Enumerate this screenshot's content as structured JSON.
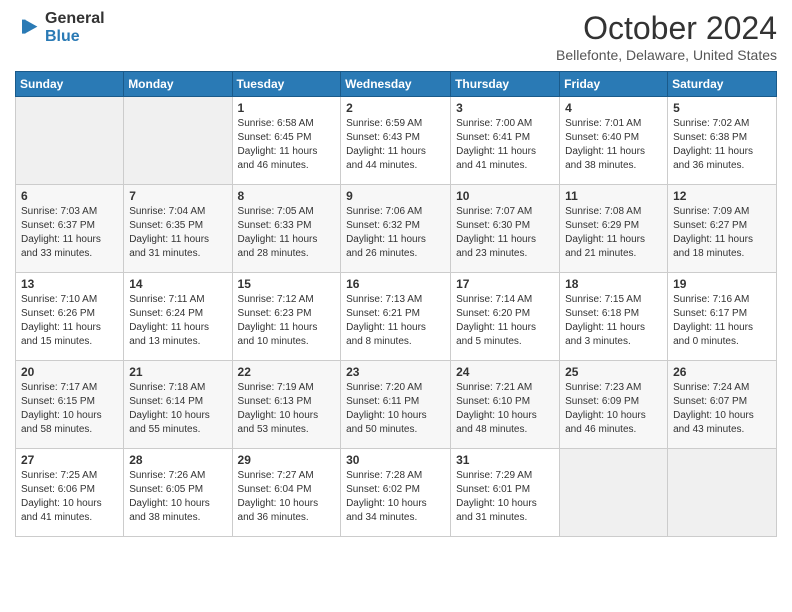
{
  "header": {
    "title": "October 2024",
    "location": "Bellefonte, Delaware, United States",
    "logo_general": "General",
    "logo_blue": "Blue"
  },
  "weekdays": [
    "Sunday",
    "Monday",
    "Tuesday",
    "Wednesday",
    "Thursday",
    "Friday",
    "Saturday"
  ],
  "weeks": [
    [
      {
        "day": "",
        "info": ""
      },
      {
        "day": "",
        "info": ""
      },
      {
        "day": "1",
        "info": "Sunrise: 6:58 AM\nSunset: 6:45 PM\nDaylight: 11 hours and 46 minutes."
      },
      {
        "day": "2",
        "info": "Sunrise: 6:59 AM\nSunset: 6:43 PM\nDaylight: 11 hours and 44 minutes."
      },
      {
        "day": "3",
        "info": "Sunrise: 7:00 AM\nSunset: 6:41 PM\nDaylight: 11 hours and 41 minutes."
      },
      {
        "day": "4",
        "info": "Sunrise: 7:01 AM\nSunset: 6:40 PM\nDaylight: 11 hours and 38 minutes."
      },
      {
        "day": "5",
        "info": "Sunrise: 7:02 AM\nSunset: 6:38 PM\nDaylight: 11 hours and 36 minutes."
      }
    ],
    [
      {
        "day": "6",
        "info": "Sunrise: 7:03 AM\nSunset: 6:37 PM\nDaylight: 11 hours and 33 minutes."
      },
      {
        "day": "7",
        "info": "Sunrise: 7:04 AM\nSunset: 6:35 PM\nDaylight: 11 hours and 31 minutes."
      },
      {
        "day": "8",
        "info": "Sunrise: 7:05 AM\nSunset: 6:33 PM\nDaylight: 11 hours and 28 minutes."
      },
      {
        "day": "9",
        "info": "Sunrise: 7:06 AM\nSunset: 6:32 PM\nDaylight: 11 hours and 26 minutes."
      },
      {
        "day": "10",
        "info": "Sunrise: 7:07 AM\nSunset: 6:30 PM\nDaylight: 11 hours and 23 minutes."
      },
      {
        "day": "11",
        "info": "Sunrise: 7:08 AM\nSunset: 6:29 PM\nDaylight: 11 hours and 21 minutes."
      },
      {
        "day": "12",
        "info": "Sunrise: 7:09 AM\nSunset: 6:27 PM\nDaylight: 11 hours and 18 minutes."
      }
    ],
    [
      {
        "day": "13",
        "info": "Sunrise: 7:10 AM\nSunset: 6:26 PM\nDaylight: 11 hours and 15 minutes."
      },
      {
        "day": "14",
        "info": "Sunrise: 7:11 AM\nSunset: 6:24 PM\nDaylight: 11 hours and 13 minutes."
      },
      {
        "day": "15",
        "info": "Sunrise: 7:12 AM\nSunset: 6:23 PM\nDaylight: 11 hours and 10 minutes."
      },
      {
        "day": "16",
        "info": "Sunrise: 7:13 AM\nSunset: 6:21 PM\nDaylight: 11 hours and 8 minutes."
      },
      {
        "day": "17",
        "info": "Sunrise: 7:14 AM\nSunset: 6:20 PM\nDaylight: 11 hours and 5 minutes."
      },
      {
        "day": "18",
        "info": "Sunrise: 7:15 AM\nSunset: 6:18 PM\nDaylight: 11 hours and 3 minutes."
      },
      {
        "day": "19",
        "info": "Sunrise: 7:16 AM\nSunset: 6:17 PM\nDaylight: 11 hours and 0 minutes."
      }
    ],
    [
      {
        "day": "20",
        "info": "Sunrise: 7:17 AM\nSunset: 6:15 PM\nDaylight: 10 hours and 58 minutes."
      },
      {
        "day": "21",
        "info": "Sunrise: 7:18 AM\nSunset: 6:14 PM\nDaylight: 10 hours and 55 minutes."
      },
      {
        "day": "22",
        "info": "Sunrise: 7:19 AM\nSunset: 6:13 PM\nDaylight: 10 hours and 53 minutes."
      },
      {
        "day": "23",
        "info": "Sunrise: 7:20 AM\nSunset: 6:11 PM\nDaylight: 10 hours and 50 minutes."
      },
      {
        "day": "24",
        "info": "Sunrise: 7:21 AM\nSunset: 6:10 PM\nDaylight: 10 hours and 48 minutes."
      },
      {
        "day": "25",
        "info": "Sunrise: 7:23 AM\nSunset: 6:09 PM\nDaylight: 10 hours and 46 minutes."
      },
      {
        "day": "26",
        "info": "Sunrise: 7:24 AM\nSunset: 6:07 PM\nDaylight: 10 hours and 43 minutes."
      }
    ],
    [
      {
        "day": "27",
        "info": "Sunrise: 7:25 AM\nSunset: 6:06 PM\nDaylight: 10 hours and 41 minutes."
      },
      {
        "day": "28",
        "info": "Sunrise: 7:26 AM\nSunset: 6:05 PM\nDaylight: 10 hours and 38 minutes."
      },
      {
        "day": "29",
        "info": "Sunrise: 7:27 AM\nSunset: 6:04 PM\nDaylight: 10 hours and 36 minutes."
      },
      {
        "day": "30",
        "info": "Sunrise: 7:28 AM\nSunset: 6:02 PM\nDaylight: 10 hours and 34 minutes."
      },
      {
        "day": "31",
        "info": "Sunrise: 7:29 AM\nSunset: 6:01 PM\nDaylight: 10 hours and 31 minutes."
      },
      {
        "day": "",
        "info": ""
      },
      {
        "day": "",
        "info": ""
      }
    ]
  ]
}
